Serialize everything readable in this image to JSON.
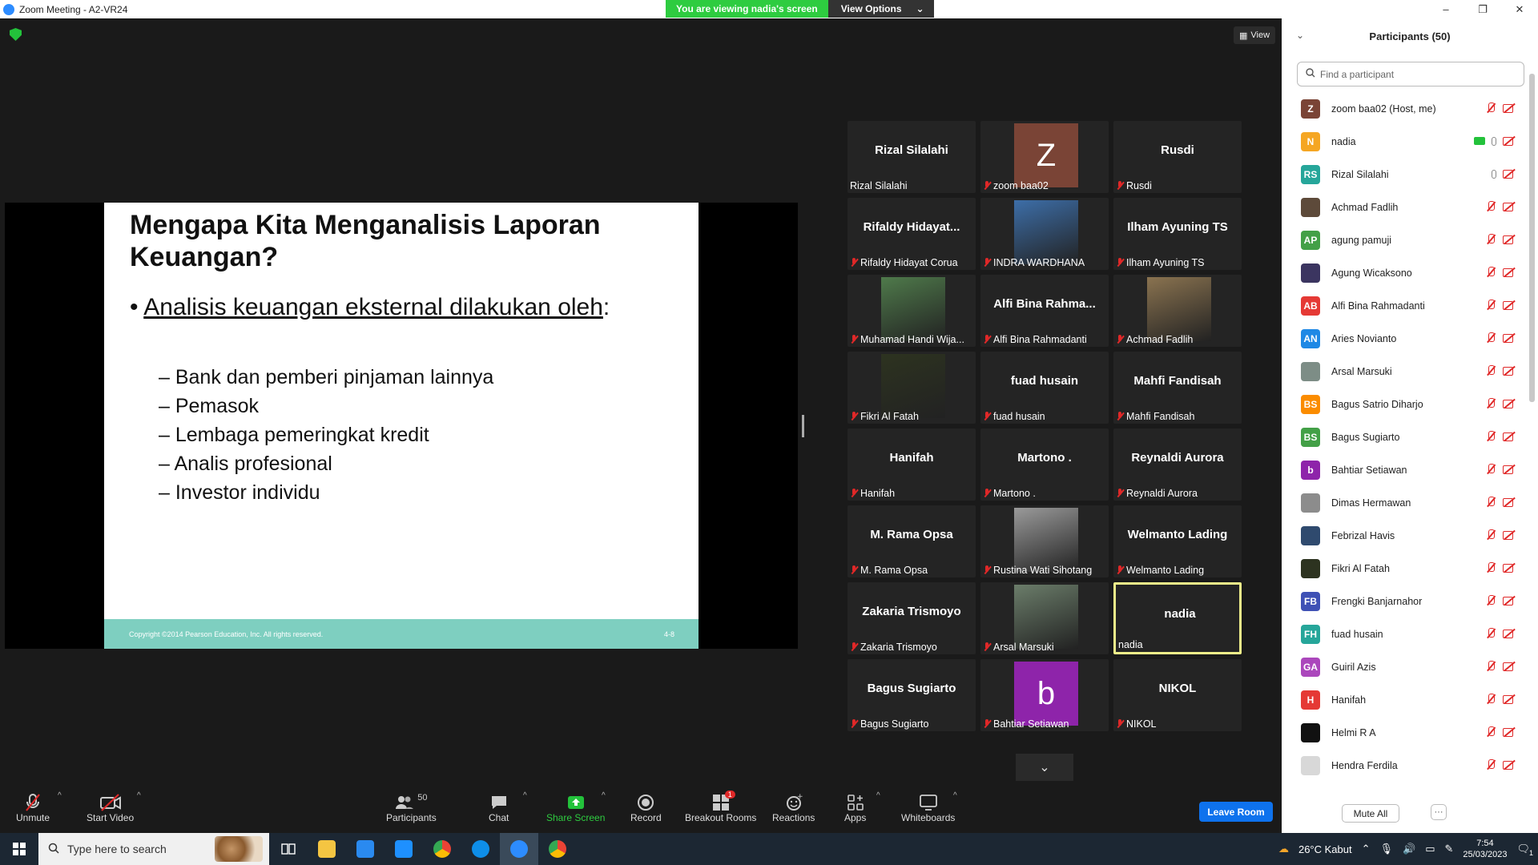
{
  "window": {
    "title": "Zoom Meeting - A2-VR24",
    "controls": [
      "–",
      "❐",
      "✕"
    ]
  },
  "share_banner": {
    "status": "You are viewing nadia's screen",
    "view_options": "View Options",
    "caret": "⌄"
  },
  "view_button": "View",
  "slide": {
    "title": "Mengapa Kita Menganalisis Laporan Keuangan?",
    "bullet_mark": "•",
    "bullet": "Analisis keuangan eksternal dilakukan oleh",
    "bullet_suffix": ":",
    "sub_bullets": [
      "– Bank dan pemberi pinjaman lainnya",
      "– Pemasok",
      "– Lembaga pemeringkat kredit",
      "– Analis profesional",
      "– Investor individu"
    ],
    "copyright": "Copyright ©2014 Pearson Education, Inc. All rights reserved.",
    "page": "4-8"
  },
  "gallery": [
    {
      "big": "Rizal Silalahi",
      "label": "Rizal Silalahi",
      "muted": false,
      "type": "name"
    },
    {
      "big": "",
      "label": "zoom baa02",
      "muted": true,
      "type": "letter",
      "letter": "Z",
      "color": "#7a4436"
    },
    {
      "big": "Rusdi",
      "label": "Rusdi",
      "muted": true,
      "type": "name"
    },
    {
      "big": "Rifaldy  Hidayat...",
      "label": "Rifaldy Hidayat Corua",
      "muted": true,
      "type": "name"
    },
    {
      "big": "",
      "label": "INDRA WARDHANA",
      "muted": true,
      "type": "photo",
      "color": "#3d6ea8"
    },
    {
      "big": "Ilham Ayuning TS",
      "label": "Ilham Ayuning TS",
      "muted": true,
      "type": "name"
    },
    {
      "big": "",
      "label": "Muhamad Handi Wija...",
      "muted": true,
      "type": "photo",
      "color": "#4f7a4b"
    },
    {
      "big": "Alfi Bina Rahma...",
      "label": "Alfi Bina Rahmadanti",
      "muted": true,
      "type": "name"
    },
    {
      "big": "",
      "label": "Achmad Fadlih",
      "muted": true,
      "type": "photo",
      "color": "#8a7350"
    },
    {
      "big": "",
      "label": "Fikri Al Fatah",
      "muted": true,
      "type": "photo",
      "color": "#2d3320"
    },
    {
      "big": "fuad husain",
      "label": "fuad husain",
      "muted": true,
      "type": "name"
    },
    {
      "big": "Mahfi Fandisah",
      "label": "Mahfi Fandisah",
      "muted": true,
      "type": "name"
    },
    {
      "big": "Hanifah",
      "label": "Hanifah",
      "muted": true,
      "type": "name"
    },
    {
      "big": "Martono .",
      "label": "Martono .",
      "muted": true,
      "type": "name"
    },
    {
      "big": "Reynaldi Aurora",
      "label": "Reynaldi Aurora",
      "muted": true,
      "type": "name"
    },
    {
      "big": "M. Rama Opsa",
      "label": "M. Rama Opsa",
      "muted": true,
      "type": "name"
    },
    {
      "big": "",
      "label": "Rustina Wati Sihotang",
      "muted": true,
      "type": "photo",
      "color": "#9a9a9a"
    },
    {
      "big": "Welmanto Lading",
      "label": "Welmanto Lading",
      "muted": true,
      "type": "name"
    },
    {
      "big": "Zakaria Trismoyo",
      "label": "Zakaria Trismoyo",
      "muted": true,
      "type": "name"
    },
    {
      "big": "",
      "label": "Arsal Marsuki",
      "muted": true,
      "type": "photo",
      "color": "#6b7d6a"
    },
    {
      "big": "nadia",
      "label": "nadia",
      "muted": false,
      "type": "name",
      "active": true
    },
    {
      "big": "Bagus Sugiarto",
      "label": "Bagus Sugiarto",
      "muted": true,
      "type": "name"
    },
    {
      "big": "",
      "label": "Bahtiar Setiawan",
      "muted": true,
      "type": "letter",
      "letter": "b",
      "color": "#8e24aa"
    },
    {
      "big": "NIKOL",
      "label": "NIKOL",
      "muted": true,
      "type": "name"
    }
  ],
  "gallery_scroll_icon": "⌄",
  "toolbar": {
    "unmute": "Unmute",
    "start_video": "Start Video",
    "participants": "Participants",
    "participants_count": "50",
    "chat": "Chat",
    "share_screen": "Share Screen",
    "record": "Record",
    "breakout_rooms": "Breakout Rooms",
    "breakout_badge": "1",
    "reactions": "Reactions",
    "apps": "Apps",
    "whiteboards": "Whiteboards",
    "leave": "Leave Room",
    "caret": "^"
  },
  "panel": {
    "title": "Participants (50)",
    "collapse_icon": "⌄",
    "search_placeholder": "Find a participant",
    "mute_all": "Mute All",
    "more": "···",
    "participants": [
      {
        "name": "zoom baa02 (Host, me)",
        "initials": "Z",
        "color": "#7a4436",
        "status": "muted"
      },
      {
        "name": "nadia",
        "initials": "N",
        "color": "#f5a623",
        "status": "sharing"
      },
      {
        "name": "Rizal Silalahi",
        "initials": "RS",
        "color": "#26a69a",
        "status": "unmuted"
      },
      {
        "name": "Achmad Fadlih",
        "initials": "",
        "color": "#5d4a3a",
        "status": "muted"
      },
      {
        "name": "agung pamuji",
        "initials": "AP",
        "color": "#43a047",
        "status": "muted"
      },
      {
        "name": "Agung Wicaksono",
        "initials": "",
        "color": "#3b3560",
        "status": "muted"
      },
      {
        "name": "Alfi Bina Rahmadanti",
        "initials": "AB",
        "color": "#e53935",
        "status": "muted"
      },
      {
        "name": "Aries Novianto",
        "initials": "AN",
        "color": "#1e88e5",
        "status": "muted"
      },
      {
        "name": "Arsal Marsuki",
        "initials": "",
        "color": "#7d8d86",
        "status": "muted"
      },
      {
        "name": "Bagus Satrio Diharjo",
        "initials": "BS",
        "color": "#fb8c00",
        "status": "muted"
      },
      {
        "name": "Bagus Sugiarto",
        "initials": "BS",
        "color": "#43a047",
        "status": "muted"
      },
      {
        "name": "Bahtiar Setiawan",
        "initials": "b",
        "color": "#8e24aa",
        "status": "muted"
      },
      {
        "name": "Dimas Hermawan",
        "initials": "",
        "color": "#8c8c8c",
        "status": "muted"
      },
      {
        "name": "Febrizal Havis",
        "initials": "",
        "color": "#2f4a6e",
        "status": "muted"
      },
      {
        "name": "Fikri Al Fatah",
        "initials": "",
        "color": "#2d3320",
        "status": "muted"
      },
      {
        "name": "Frengki Banjarnahor",
        "initials": "FB",
        "color": "#3f51b5",
        "status": "muted"
      },
      {
        "name": "fuad husain",
        "initials": "FH",
        "color": "#26a69a",
        "status": "muted"
      },
      {
        "name": "Guiril Azis",
        "initials": "GA",
        "color": "#ab47bc",
        "status": "muted"
      },
      {
        "name": "Hanifah",
        "initials": "H",
        "color": "#e53935",
        "status": "muted"
      },
      {
        "name": "Helmi R A",
        "initials": "",
        "color": "#111111",
        "status": "muted"
      },
      {
        "name": "Hendra Ferdila",
        "initials": "",
        "color": "#d8d8d8",
        "status": "muted"
      }
    ]
  },
  "taskbar": {
    "search_placeholder": "Type here to search",
    "weather": "26°C  Kabut",
    "time": "7:54",
    "date": "25/03/2023",
    "notif_count": "1"
  }
}
